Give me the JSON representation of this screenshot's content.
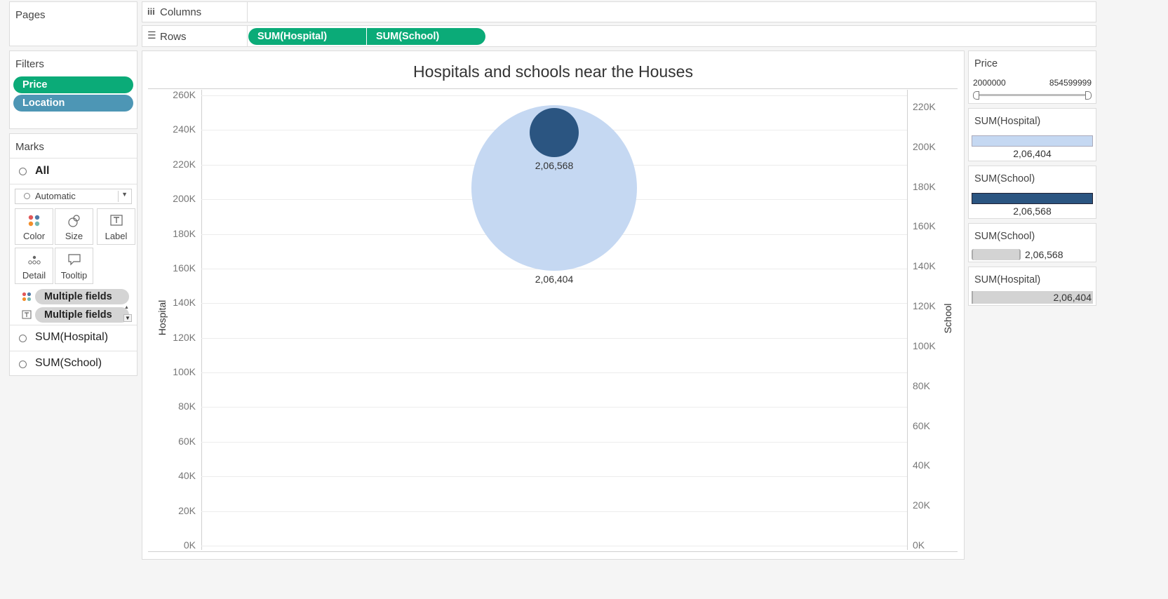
{
  "pages": {
    "label": "Pages"
  },
  "shelves": {
    "columns_label": "Columns",
    "rows_label": "Rows",
    "row_pills": [
      "SUM(Hospital)",
      "SUM(School)"
    ]
  },
  "filters": {
    "label": "Filters",
    "items": [
      "Price",
      "Location"
    ]
  },
  "marks": {
    "label": "Marks",
    "all_label": "All",
    "mark_type": "Automatic",
    "buttons": {
      "color": "Color",
      "size": "Size",
      "label": "Label",
      "detail": "Detail",
      "tooltip": "Tooltip"
    },
    "fields": [
      "Multiple fields",
      "Multiple fields"
    ],
    "cards": [
      "SUM(Hospital)",
      "SUM(School)"
    ]
  },
  "chart_data": {
    "type": "scatter",
    "title": "Hospitals and schools near the Houses",
    "ylabel": "Hospital",
    "y2label": "School",
    "yticks": [
      "260K",
      "240K",
      "220K",
      "200K",
      "180K",
      "160K",
      "140K",
      "120K",
      "100K",
      "80K",
      "60K",
      "40K",
      "20K",
      "0K"
    ],
    "y2ticks": [
      "220K",
      "200K",
      "180K",
      "160K",
      "140K",
      "120K",
      "100K",
      "80K",
      "60K",
      "40K",
      "20K",
      "0K"
    ],
    "ylim": [
      0,
      260000
    ],
    "y2lim": [
      0,
      225000
    ],
    "series": [
      {
        "name": "SUM(Hospital)",
        "value": 206404,
        "label": "2,06,404",
        "color": "#c5d8f2"
      },
      {
        "name": "SUM(School)",
        "value": 206568,
        "label": "2,06,568",
        "color": "#2b5581"
      }
    ]
  },
  "legends": {
    "price": {
      "title": "Price",
      "min": "2000000",
      "max": "854599999"
    },
    "hospital_color": {
      "title": "SUM(Hospital)",
      "value": "2,06,404",
      "color": "#c5d8f2"
    },
    "school_color": {
      "title": "SUM(School)",
      "value": "2,06,568",
      "color": "#2b5581"
    },
    "school_size": {
      "title": "SUM(School)",
      "value": "2,06,568"
    },
    "hospital_size": {
      "title": "SUM(Hospital)",
      "value": "2,06,404"
    }
  }
}
